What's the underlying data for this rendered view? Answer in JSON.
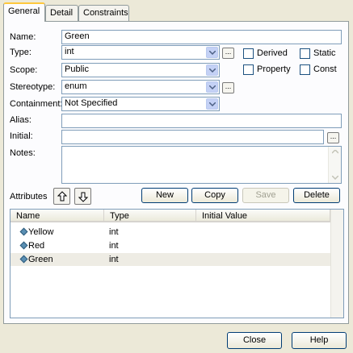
{
  "tabs": [
    {
      "label": "General"
    },
    {
      "label": "Detail"
    },
    {
      "label": "Constraints"
    }
  ],
  "form": {
    "name_label": "Name:",
    "name_value": "Green",
    "type_label": "Type:",
    "type_value": "int",
    "scope_label": "Scope:",
    "scope_value": "Public",
    "stereotype_label": "Stereotype:",
    "stereotype_value": "enum",
    "containment_label": "Containment:",
    "containment_value": "Not Specified",
    "alias_label": "Alias:",
    "alias_value": "",
    "initial_label": "Initial:",
    "initial_value": "",
    "notes_label": "Notes:",
    "notes_value": "",
    "ellipsis": "..."
  },
  "checks": {
    "derived": "Derived",
    "static": "Static",
    "property": "Property",
    "const": "Const"
  },
  "attributes": {
    "label": "Attributes",
    "new_button": "New",
    "copy_button": "Copy",
    "save_button": "Save",
    "delete_button": "Delete",
    "columns": [
      "Name",
      "Type",
      "Initial Value"
    ],
    "rows": [
      {
        "name": "Yellow",
        "type": "int",
        "initial": ""
      },
      {
        "name": "Red",
        "type": "int",
        "initial": ""
      },
      {
        "name": "Green",
        "type": "int",
        "initial": ""
      }
    ]
  },
  "footer": {
    "close_button": "Close",
    "help_button": "Help"
  },
  "colors": {
    "dialog_bg": "#ece9d8",
    "active_tab_accent": "#ffc83c",
    "field_border": "#7f9db9",
    "combo_arrow": "#c4d1f5"
  }
}
